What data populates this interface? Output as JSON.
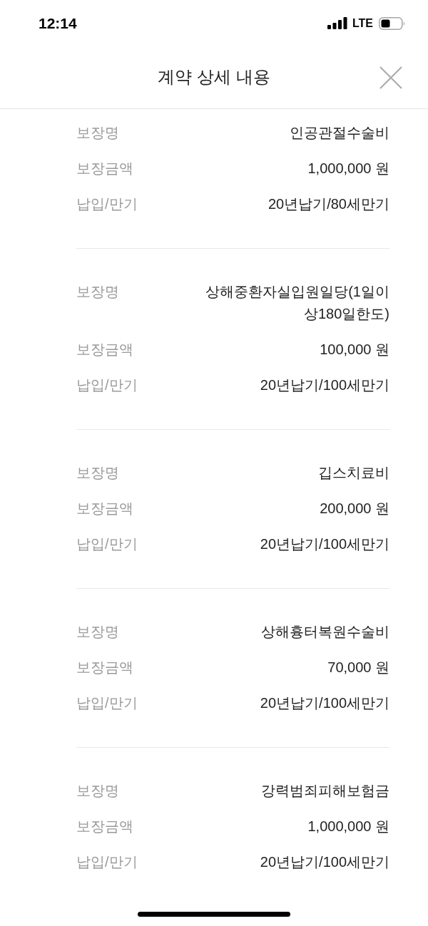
{
  "status_bar": {
    "time": "12:14",
    "network": "LTE"
  },
  "header": {
    "title": "계약 상세 내용"
  },
  "coverages": [
    {
      "fields": [
        {
          "label": "보장명",
          "value": "인공관절수술비"
        },
        {
          "label": "보장금액",
          "value": "1,000,000 원"
        },
        {
          "label": "납입/만기",
          "value": "20년납기/80세만기"
        }
      ]
    },
    {
      "fields": [
        {
          "label": "보장명",
          "value": "상해중환자실입원일당(1일이상180일한도)"
        },
        {
          "label": "보장금액",
          "value": "100,000 원"
        },
        {
          "label": "납입/만기",
          "value": "20년납기/100세만기"
        }
      ]
    },
    {
      "fields": [
        {
          "label": "보장명",
          "value": "깁스치료비"
        },
        {
          "label": "보장금액",
          "value": "200,000 원"
        },
        {
          "label": "납입/만기",
          "value": "20년납기/100세만기"
        }
      ]
    },
    {
      "fields": [
        {
          "label": "보장명",
          "value": "상해흉터복원수술비"
        },
        {
          "label": "보장금액",
          "value": "70,000 원"
        },
        {
          "label": "납입/만기",
          "value": "20년납기/100세만기"
        }
      ]
    },
    {
      "fields": [
        {
          "label": "보장명",
          "value": "강력범죄피해보험금"
        },
        {
          "label": "보장금액",
          "value": "1,000,000 원"
        },
        {
          "label": "납입/만기",
          "value": "20년납기/100세만기"
        }
      ]
    }
  ]
}
